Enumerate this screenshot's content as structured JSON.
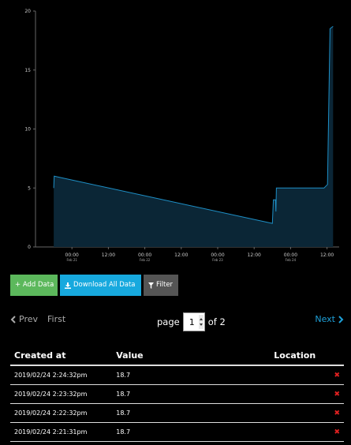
{
  "chart_data": {
    "type": "area",
    "title": "",
    "xlabel": "",
    "ylabel": "",
    "ylim": [
      0,
      20
    ],
    "y_ticks": [
      "0",
      "5",
      "10",
      "15",
      "20"
    ],
    "x_ticks": [
      {
        "label": "00:00",
        "sub": "Feb 21"
      },
      {
        "label": "12:00",
        "sub": ""
      },
      {
        "label": "00:00",
        "sub": "Feb 22"
      },
      {
        "label": "12:00",
        "sub": ""
      },
      {
        "label": "00:00",
        "sub": "Feb 23"
      },
      {
        "label": "12:00",
        "sub": ""
      },
      {
        "label": "00:00",
        "sub": "Feb 24"
      },
      {
        "label": "12:00",
        "sub": ""
      }
    ],
    "series": [
      {
        "points": [
          {
            "x": "2019-02-20T18:00",
            "y": 5.0
          },
          {
            "x": "2019-02-20T18:10",
            "y": 6.0
          },
          {
            "x": "2019-02-23T18:00",
            "y": 2.0
          },
          {
            "x": "2019-02-23T18:20",
            "y": 4.0
          },
          {
            "x": "2019-02-23T19:00",
            "y": 4.0
          },
          {
            "x": "2019-02-23T19:10",
            "y": 3.0
          },
          {
            "x": "2019-02-23T19:20",
            "y": 5.0
          },
          {
            "x": "2019-02-24T11:00",
            "y": 5.0
          },
          {
            "x": "2019-02-24T12:10",
            "y": 5.3
          },
          {
            "x": "2019-02-24T13:00",
            "y": 18.5
          },
          {
            "x": "2019-02-24T14:00",
            "y": 18.7
          }
        ]
      }
    ],
    "colors": {
      "line": "#1e8fc6",
      "fill": "#0b2636"
    },
    "grid": false
  },
  "toolbar": {
    "add_label": "+ Add Data",
    "download_label": "Download All Data",
    "filter_label": "Filter"
  },
  "pager": {
    "prev_label": "Prev",
    "first_label": "First",
    "page_label": "page",
    "current_page": "1",
    "of_label": "of 2",
    "next_label": "Next"
  },
  "table": {
    "headers": {
      "created": "Created at",
      "value": "Value",
      "location": "Location"
    },
    "rows": [
      {
        "created": "2019/02/24 2:24:32pm",
        "value": "18.7",
        "location": ""
      },
      {
        "created": "2019/02/24 2:23:32pm",
        "value": "18.7",
        "location": ""
      },
      {
        "created": "2019/02/24 2:22:32pm",
        "value": "18.7",
        "location": ""
      },
      {
        "created": "2019/02/24 2:21:31pm",
        "value": "18.7",
        "location": ""
      }
    ],
    "delete_glyph": "✖"
  }
}
